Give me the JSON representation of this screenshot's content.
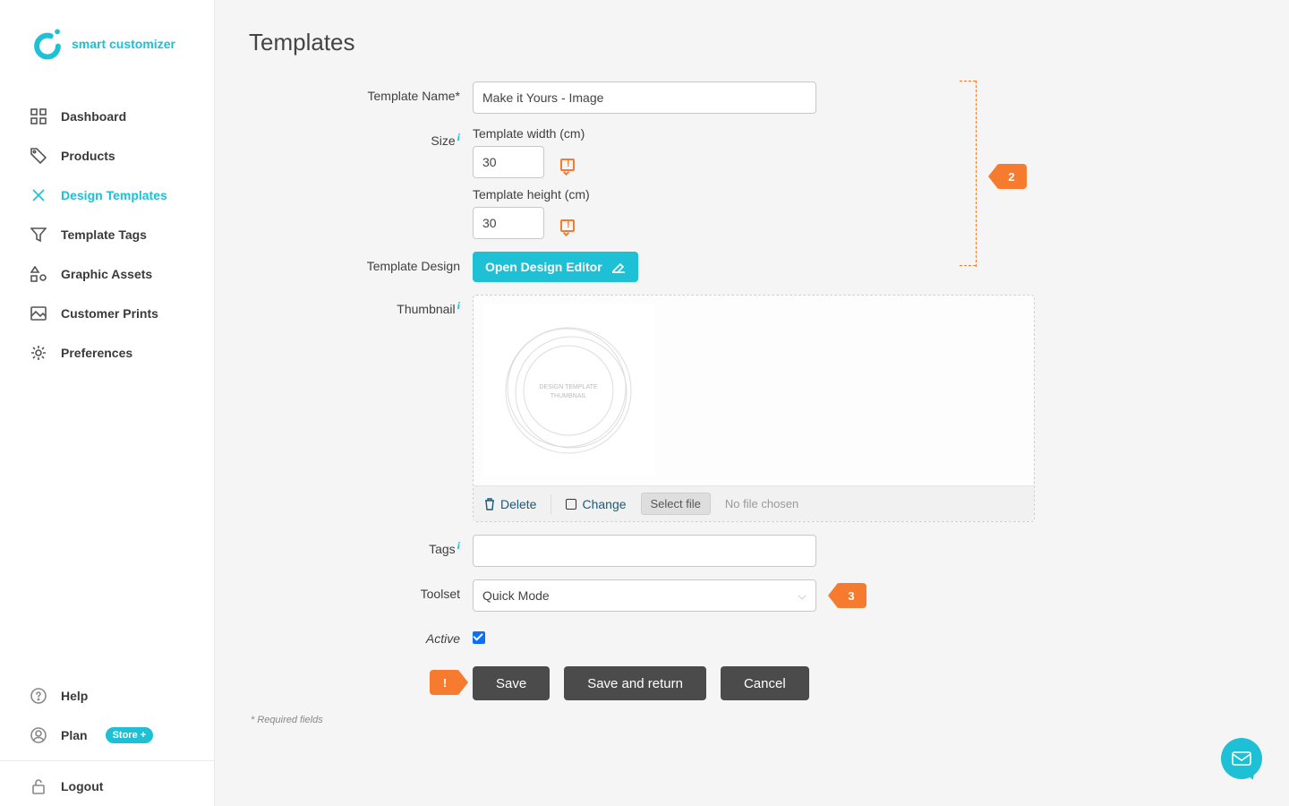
{
  "brand": "smart customizer",
  "nav": {
    "dashboard": "Dashboard",
    "products": "Products",
    "designTemplates": "Design Templates",
    "templateTags": "Template Tags",
    "graphicAssets": "Graphic Assets",
    "customerPrints": "Customer Prints",
    "preferences": "Preferences",
    "help": "Help",
    "plan": "Plan",
    "planPill": "Store +",
    "logout": "Logout"
  },
  "page": {
    "title": "Templates"
  },
  "labels": {
    "templateName": "Template Name*",
    "size": "Size",
    "templateWidth": "Template width (cm)",
    "templateHeight": "Template height (cm)",
    "templateDesign": "Template Design",
    "openDesignEditor": "Open Design Editor",
    "thumbnail": "Thumbnail",
    "thumbText1": "DESIGN TEMPLATE",
    "thumbText2": "THUMBNAIL",
    "delete": "Delete",
    "change": "Change",
    "selectFile": "Select file",
    "noFileChosen": "No file chosen",
    "tags": "Tags",
    "toolset": "Toolset",
    "active": "Active",
    "required": "* Required fields"
  },
  "values": {
    "templateName": "Make it Yours - Image",
    "width": "30",
    "height": "30",
    "toolset": "Quick Mode",
    "activeChecked": true
  },
  "buttons": {
    "save": "Save",
    "saveReturn": "Save and return",
    "cancel": "Cancel"
  },
  "markers": {
    "two": "2",
    "three": "3",
    "ex": "!"
  }
}
